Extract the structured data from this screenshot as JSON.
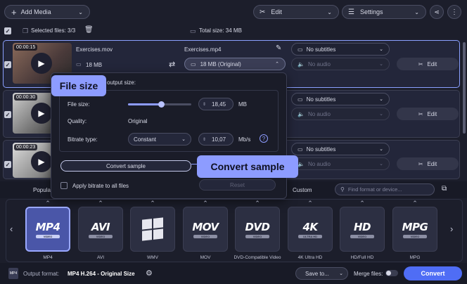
{
  "toolbar": {
    "add_media": "Add Media",
    "edit": "Edit",
    "settings": "Settings"
  },
  "selection_bar": {
    "selected_files": "Selected files: 3/3",
    "total_size": "Total size: 34 MB"
  },
  "files": [
    {
      "duration": "00:00:15",
      "source_name": "Exercises.mov",
      "source_size": "18 MB",
      "output_name": "Exercises.mp4",
      "output_size": "18 MB (Original)",
      "subtitles": "No subtitles",
      "audio": "No audio",
      "edit": "Edit"
    },
    {
      "duration": "00:00:30",
      "subtitles": "No subtitles",
      "audio": "No audio",
      "edit": "Edit"
    },
    {
      "duration": "00:00:23",
      "subtitles": "No subtitles",
      "audio": "No audio",
      "edit": "Edit"
    }
  ],
  "size_panel": {
    "heading_partial": "output size:",
    "file_size_label": "File size:",
    "file_size_value": "18,45",
    "file_size_unit": "MB",
    "file_size_slider_fraction": 0.52,
    "quality_label": "Quality:",
    "quality_value": "Original",
    "bitrate_type_label": "Bitrate type:",
    "bitrate_type_value": "Constant",
    "bitrate_value": "10,07",
    "bitrate_unit": "Mb/s",
    "convert_sample": "Convert sample",
    "apply_bitrate": "Apply bitrate to all files",
    "reset": "Reset"
  },
  "callouts": {
    "file_size": "File size",
    "convert_sample": "Convert sample"
  },
  "format_tabs": {
    "popular": "Popula",
    "custom": "Custom",
    "search_placeholder": "Find format or device..."
  },
  "formats": [
    {
      "name": "MP4",
      "badge": "VIDEO",
      "label": "MP4",
      "selected": true
    },
    {
      "name": "AVI",
      "badge": "VIDEO",
      "label": "AVI",
      "selected": false
    },
    {
      "name": "",
      "badge": "",
      "label": "WMV",
      "selected": false,
      "icon": "windows-logo-icon"
    },
    {
      "name": "MOV",
      "badge": "VIDEO",
      "label": "MOV",
      "selected": false
    },
    {
      "name": "DVD",
      "badge": "VIDEO",
      "label": "DVD-Compatible Video",
      "selected": false
    },
    {
      "name": "4K",
      "badge": "ULTRA HD",
      "label": "4K Ultra HD",
      "selected": false
    },
    {
      "name": "HD",
      "badge": "VIDEO",
      "label": "HD/Full HD",
      "selected": false
    },
    {
      "name": "MPG",
      "badge": "VIDEO",
      "label": "MPG",
      "selected": false
    }
  ],
  "bottom_bar": {
    "output_format_label": "Output format:",
    "output_format_value": "MP4 H.264 - Original Size",
    "save_to": "Save to...",
    "merge_files": "Merge files:",
    "convert": "Convert"
  },
  "colors": {
    "accent": "#4f6df5",
    "callout": "#8d9cff",
    "background": "#1c1e2b"
  }
}
